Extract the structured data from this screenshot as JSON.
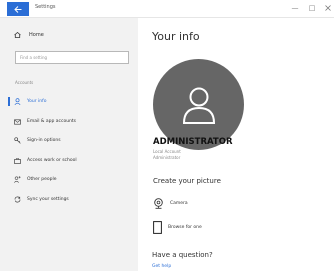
{
  "window": {
    "title": "Settings",
    "minimize": "—",
    "maximize": "□"
  },
  "sidebar": {
    "home_label": "Home",
    "search_placeholder": "Find a setting",
    "section_label": "Accounts",
    "items": [
      {
        "label": "Your info",
        "icon": "person-icon",
        "active": true
      },
      {
        "label": "Email & app accounts",
        "icon": "mail-icon",
        "active": false
      },
      {
        "label": "Sign-in options",
        "icon": "key-icon",
        "active": false
      },
      {
        "label": "Access work or school",
        "icon": "briefcase-icon",
        "active": false
      },
      {
        "label": "Other people",
        "icon": "people-icon",
        "active": false
      },
      {
        "label": "Sync your settings",
        "icon": "sync-icon",
        "active": false
      }
    ]
  },
  "main": {
    "title": "Your info",
    "username": "ADMINISTRATOR",
    "account_type": "Local Account",
    "account_role": "Administrator",
    "create_picture_heading": "Create your picture",
    "options": [
      {
        "label": "Camera",
        "icon": "camera-icon"
      },
      {
        "label": "Browse for one",
        "icon": "browse-icon"
      }
    ],
    "help_heading": "Have a question?",
    "help_link": "Get help"
  },
  "colors": {
    "accent": "#2b6ed6",
    "sidebar_bg": "#f2f2f2",
    "avatar_bg": "#666666"
  }
}
